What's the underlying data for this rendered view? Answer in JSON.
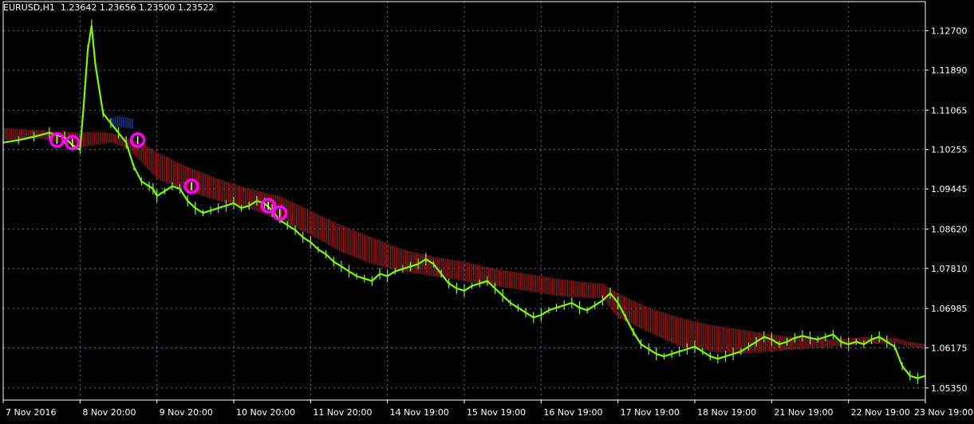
{
  "header": {
    "symbol": "EURUSD,H1",
    "open": "1.23642",
    "high": "1.23656",
    "low": "1.23500",
    "close": "1.23522"
  },
  "colors": {
    "background": "#000000",
    "grid": "#5a6a7a",
    "price_line": "#7CFC00",
    "indicator_band": "#B22222",
    "marker": "#FF00FF",
    "spike_band": "#1E3A9E",
    "text": "#FFFFFF"
  },
  "chart_data": {
    "type": "line",
    "title": "EURUSD,H1",
    "y_axis": {
      "ticks": [
        "1.12700",
        "1.11890",
        "1.11065",
        "1.10255",
        "1.09445",
        "1.08620",
        "1.07810",
        "1.06985",
        "1.06175",
        "1.05350"
      ],
      "ylim": [
        1.051,
        1.133
      ]
    },
    "x_axis": {
      "ticks": [
        "7 Nov 2016",
        "8 Nov 20:00",
        "9 Nov 20:00",
        "10 Nov 20:00",
        "11 Nov 20:00",
        "14 Nov 19:00",
        "15 Nov 19:00",
        "16 Nov 19:00",
        "17 Nov 19:00",
        "18 Nov 19:00",
        "21 Nov 19:00",
        "22 Nov 19:00",
        "23 Nov 19:00"
      ],
      "xlim": [
        0,
        120
      ]
    },
    "grid": true,
    "series": [
      {
        "kind": "price",
        "x": [
          0,
          2,
          4,
          6,
          8,
          9,
          10,
          10.5,
          11,
          11.5,
          12,
          13,
          14,
          15,
          16,
          17,
          18,
          19,
          19.5,
          20,
          21,
          22,
          23,
          24,
          25,
          26,
          27,
          28,
          29,
          30,
          31,
          32,
          33,
          34,
          35,
          36,
          37,
          38,
          39,
          40,
          41,
          42,
          43,
          44,
          45,
          46,
          47,
          48,
          49,
          50,
          51,
          52,
          53,
          54,
          55,
          56,
          57,
          58,
          59,
          60,
          61,
          62,
          63,
          64,
          65,
          66,
          67,
          68,
          69,
          70,
          71,
          72,
          73,
          74,
          75,
          76,
          77,
          78,
          79,
          80,
          81,
          82,
          83,
          84,
          85,
          86,
          87,
          88,
          89,
          90,
          91,
          92,
          93,
          94,
          95,
          96,
          97,
          98,
          99,
          100,
          101,
          102,
          103,
          104,
          105,
          106,
          107,
          108,
          109,
          110,
          111,
          112,
          113,
          114,
          115,
          116,
          117,
          118,
          119,
          120
        ],
        "y": [
          1.104,
          1.1045,
          1.1052,
          1.106,
          1.105,
          1.1035,
          1.1025,
          1.112,
          1.123,
          1.128,
          1.12,
          1.11,
          1.108,
          1.106,
          1.104,
          1.099,
          1.096,
          1.095,
          1.0945,
          1.093,
          1.094,
          1.095,
          1.0945,
          1.092,
          1.0905,
          1.0895,
          1.09,
          1.0905,
          1.091,
          1.0915,
          1.0905,
          1.091,
          1.092,
          1.0915,
          1.09,
          1.088,
          1.087,
          1.086,
          1.0845,
          1.0835,
          1.082,
          1.081,
          1.0795,
          1.0785,
          1.0775,
          1.0765,
          1.076,
          1.0755,
          1.077,
          1.0765,
          1.0775,
          1.078,
          1.0785,
          1.079,
          1.08,
          1.079,
          1.077,
          1.075,
          1.074,
          1.0735,
          1.0745,
          1.075,
          1.0755,
          1.074,
          1.0725,
          1.071,
          1.07,
          1.069,
          1.068,
          1.0685,
          1.0695,
          1.07,
          1.0705,
          1.071,
          1.07,
          1.0695,
          1.0705,
          1.0715,
          1.073,
          1.071,
          1.068,
          1.065,
          1.0625,
          1.0615,
          1.0605,
          1.06,
          1.0605,
          1.061,
          1.0615,
          1.062,
          1.061,
          1.06,
          1.0595,
          1.06,
          1.0605,
          1.061,
          1.062,
          1.063,
          1.064,
          1.0635,
          1.0625,
          1.063,
          1.0638,
          1.0642,
          1.0638,
          1.0635,
          1.064,
          1.0645,
          1.063,
          1.0625,
          1.063,
          1.0625,
          1.0635,
          1.064,
          1.063,
          1.062,
          1.058,
          1.056,
          1.0555,
          1.056
        ]
      },
      {
        "kind": "band",
        "x": [
          0,
          5,
          10,
          12,
          14,
          16,
          18,
          20,
          24,
          28,
          32,
          36,
          40,
          44,
          48,
          52,
          56,
          60,
          64,
          68,
          72,
          76,
          78,
          80,
          84,
          88,
          92,
          96,
          100,
          104,
          108,
          112,
          116,
          118,
          120
        ],
        "upper": [
          1.107,
          1.1065,
          1.106,
          1.1062,
          1.106,
          1.105,
          1.104,
          1.102,
          1.099,
          1.0965,
          1.0945,
          1.093,
          1.09,
          1.087,
          1.0845,
          1.082,
          1.0805,
          1.0795,
          1.078,
          1.077,
          1.076,
          1.0752,
          1.075,
          1.073,
          1.07,
          1.068,
          1.0665,
          1.0655,
          1.0645,
          1.0638,
          1.0635,
          1.064,
          1.0638,
          1.063,
          1.0625
        ],
        "lower": [
          1.1045,
          1.1048,
          1.103,
          1.1035,
          1.104,
          1.103,
          1.1,
          1.0965,
          1.094,
          1.092,
          1.0905,
          1.088,
          1.085,
          1.0815,
          1.079,
          1.0775,
          1.0765,
          1.0755,
          1.0745,
          1.0735,
          1.0725,
          1.072,
          1.072,
          1.068,
          1.065,
          1.062,
          1.061,
          1.0605,
          1.061,
          1.0615,
          1.062,
          1.0625,
          1.0628,
          1.062,
          1.0615
        ]
      },
      {
        "kind": "markers",
        "x": [
          7,
          9,
          17.5,
          24.5,
          34.5,
          36
        ],
        "y": [
          1.1045,
          1.104,
          1.1045,
          1.095,
          1.091,
          1.0895
        ]
      },
      {
        "kind": "spike_band",
        "x": [
          14,
          15,
          16,
          17
        ],
        "upper": [
          1.109,
          1.1095,
          1.1092,
          1.1088
        ],
        "lower": [
          1.107,
          1.1072,
          1.107,
          1.1068
        ]
      }
    ]
  }
}
